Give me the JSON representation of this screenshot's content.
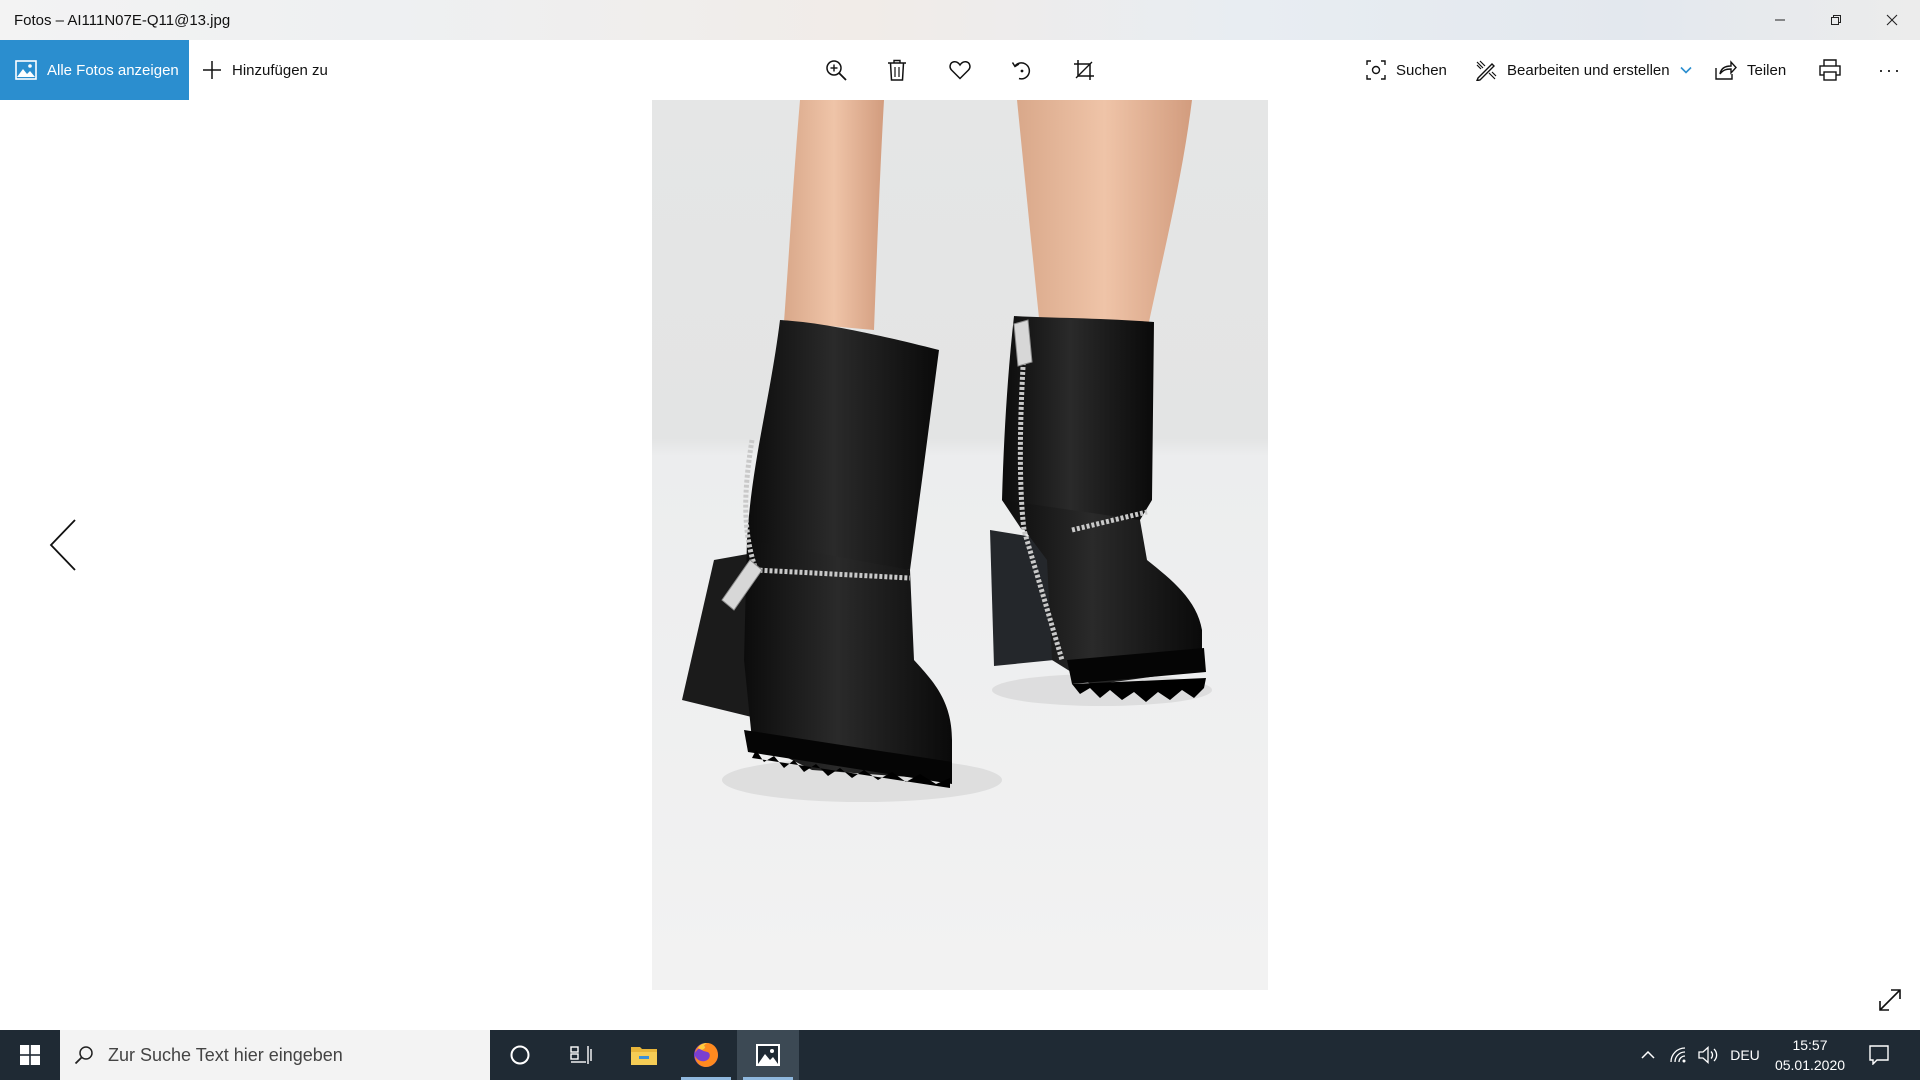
{
  "window": {
    "title": "Fotos – AI111N07E-Q11@13.jpg",
    "controls": [
      "minimize-icon",
      "restore-icon",
      "close-icon"
    ]
  },
  "toolbar": {
    "all_photos_label": "Alle Fotos anzeigen",
    "add_to_label": "Hinzufügen zu",
    "center_icons": [
      "zoom-in-icon",
      "delete-icon",
      "favorite-heart-icon",
      "rotate-icon",
      "crop-icon"
    ],
    "search_label": "Suchen",
    "edit_create_label": "Bearbeiten und erstellen",
    "share_label": "Teilen",
    "more_label": "···"
  },
  "taskbar": {
    "search_placeholder": "Zur Suche Text hier eingeben",
    "apps": [
      "cortana-icon",
      "task-view-icon",
      "file-explorer-icon",
      "firefox-icon",
      "photos-app-icon"
    ],
    "language": "DEU",
    "time": "15:57",
    "date": "05.01.2020"
  },
  "colors": {
    "accent": "#2b8ecf",
    "taskbar": "#1f2a34"
  }
}
